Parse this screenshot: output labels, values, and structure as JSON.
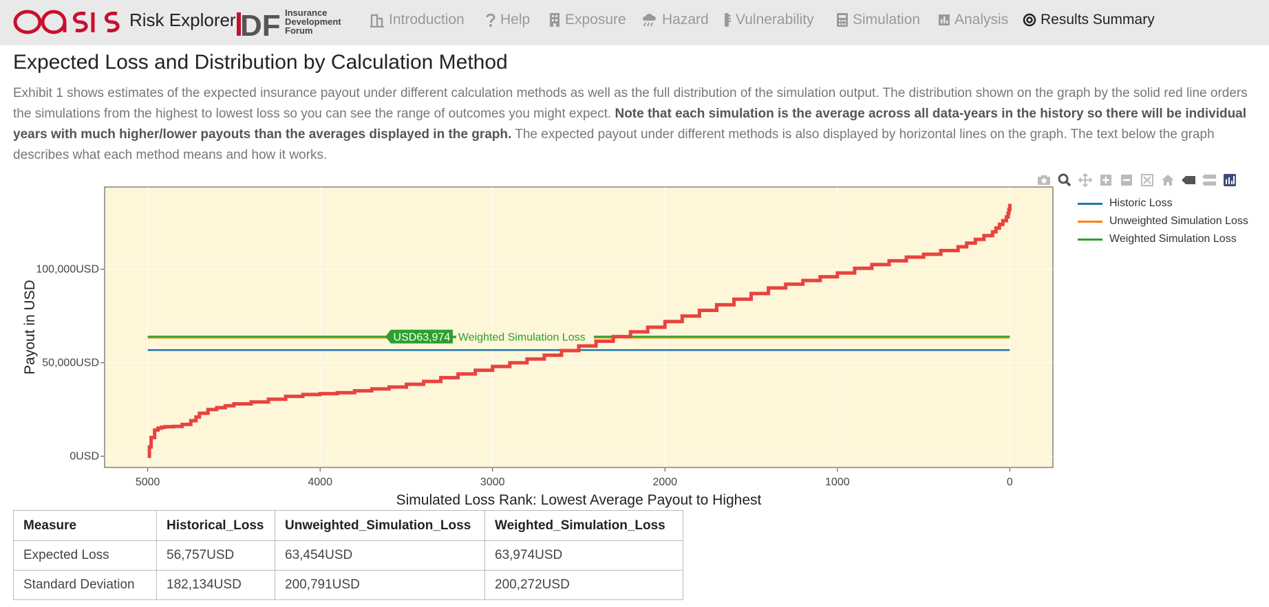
{
  "app": {
    "title": "Risk Explorer",
    "logo_oasis_text": "oasis",
    "logo_idf_letters": "IDF",
    "logo_idf_lines": [
      "Insurance",
      "Development",
      "Forum"
    ]
  },
  "nav": [
    {
      "label": "Introduction",
      "icon": "building-icon",
      "active": false
    },
    {
      "label": "Help",
      "icon": "question-icon",
      "active": false
    },
    {
      "label": "Exposure",
      "icon": "office-icon",
      "active": false
    },
    {
      "label": "Hazard",
      "icon": "cloud-rain-icon",
      "active": false
    },
    {
      "label": "Vulnerability",
      "icon": "thermometer-icon",
      "active": false
    },
    {
      "label": "Simulation",
      "icon": "calculator-icon",
      "active": false
    },
    {
      "label": "Analysis",
      "icon": "bar-chart-icon",
      "active": false
    },
    {
      "label": "Results Summary",
      "icon": "target-icon",
      "active": true
    }
  ],
  "page": {
    "title": "Expected Loss and Distribution by Calculation Method",
    "intro_part1": "Exhibit 1 shows estimates of the expected insurance payout under different calculation methods as well as the full distribution of the simulation output. The distribution shown on the graph by the solid red line orders the simulations from the highest to lowest loss so you can see the range of outcomes you might expect. ",
    "intro_bold": "Note that each simulation is the average across all data-years in the history so there will be individual years with much higher/lower payouts than the averages displayed in the graph.",
    "intro_part2": " The expected payout under different methods is also displayed by horizontal lines on the graph. The text below the graph describes what each method means and how it works."
  },
  "modebar": [
    "camera-icon",
    "zoom-icon",
    "pan-icon",
    "zoom-in-icon",
    "zoom-out-icon",
    "autoscale-icon",
    "home-icon",
    "hover-closest-icon",
    "hover-compare-icon",
    "plotly-logo-icon"
  ],
  "colors": {
    "plot_bg": "#fdf6d8",
    "distribution": "#e8433f",
    "historic": "#1f77b4",
    "unweighted": "#ff7f0e",
    "weighted": "#2ca02c"
  },
  "chart_data": {
    "type": "line",
    "xlabel": "Simulated Loss Rank: Lowest Average Payout to Highest",
    "ylabel": "Payout in USD",
    "xlim": [
      5250,
      -250
    ],
    "ylim": [
      -6000,
      144000
    ],
    "x_ticks": [
      5000,
      4000,
      3000,
      2000,
      1000,
      0
    ],
    "y_ticks": [
      0,
      50000,
      100000
    ],
    "y_tick_labels": [
      "0USD",
      "50,000USD",
      "100,000USD"
    ],
    "legend_position": "right",
    "series": [
      {
        "name": "Historic Loss",
        "type": "hline",
        "value": 56757,
        "x": [
          5000,
          0
        ]
      },
      {
        "name": "Unweighted Simulation Loss",
        "type": "hline",
        "value": 63454,
        "x": [
          5000,
          0
        ]
      },
      {
        "name": "Weighted Simulation Loss",
        "type": "hline",
        "value": 63974,
        "x": [
          5000,
          0
        ]
      },
      {
        "name": "",
        "type": "step",
        "x": [
          5000,
          4990,
          4980,
          4960,
          4940,
          4920,
          4900,
          4850,
          4800,
          4750,
          4720,
          4700,
          4650,
          4600,
          4550,
          4500,
          4400,
          4300,
          4200,
          4100,
          4000,
          3900,
          3800,
          3700,
          3600,
          3500,
          3400,
          3300,
          3200,
          3100,
          3000,
          2900,
          2800,
          2700,
          2600,
          2500,
          2400,
          2300,
          2200,
          2100,
          2000,
          1900,
          1800,
          1700,
          1600,
          1500,
          1400,
          1300,
          1200,
          1100,
          1000,
          900,
          800,
          700,
          600,
          500,
          400,
          300,
          250,
          200,
          150,
          100,
          80,
          60,
          40,
          20,
          10,
          5,
          0
        ],
        "y": [
          0,
          5000,
          10000,
          14000,
          15000,
          15500,
          15800,
          16000,
          17000,
          19000,
          21000,
          23000,
          25000,
          26000,
          27000,
          28000,
          29000,
          30500,
          32000,
          33000,
          33500,
          34000,
          35000,
          36000,
          37000,
          38500,
          40000,
          42000,
          44000,
          46000,
          48000,
          50000,
          52000,
          54000,
          56500,
          59000,
          61500,
          64000,
          66500,
          69000,
          72000,
          75000,
          78000,
          81000,
          84000,
          87000,
          90000,
          92000,
          94000,
          96000,
          98000,
          100500,
          102500,
          104500,
          106500,
          108000,
          110000,
          112000,
          114000,
          116000,
          118000,
          120000,
          122000,
          124000,
          126000,
          128000,
          130000,
          132000,
          135000
        ]
      }
    ],
    "annotation": {
      "label": "USD63,974",
      "text": "Weighted Simulation Loss"
    }
  },
  "table": {
    "headers": [
      "Measure",
      "Historical_Loss",
      "Unweighted_Simulation_Loss",
      "Weighted_Simulation_Loss"
    ],
    "rows": [
      [
        "Expected Loss",
        "56,757USD",
        "63,454USD",
        "63,974USD"
      ],
      [
        "Standard Deviation",
        "182,134USD",
        "200,791USD",
        "200,272USD"
      ]
    ]
  }
}
